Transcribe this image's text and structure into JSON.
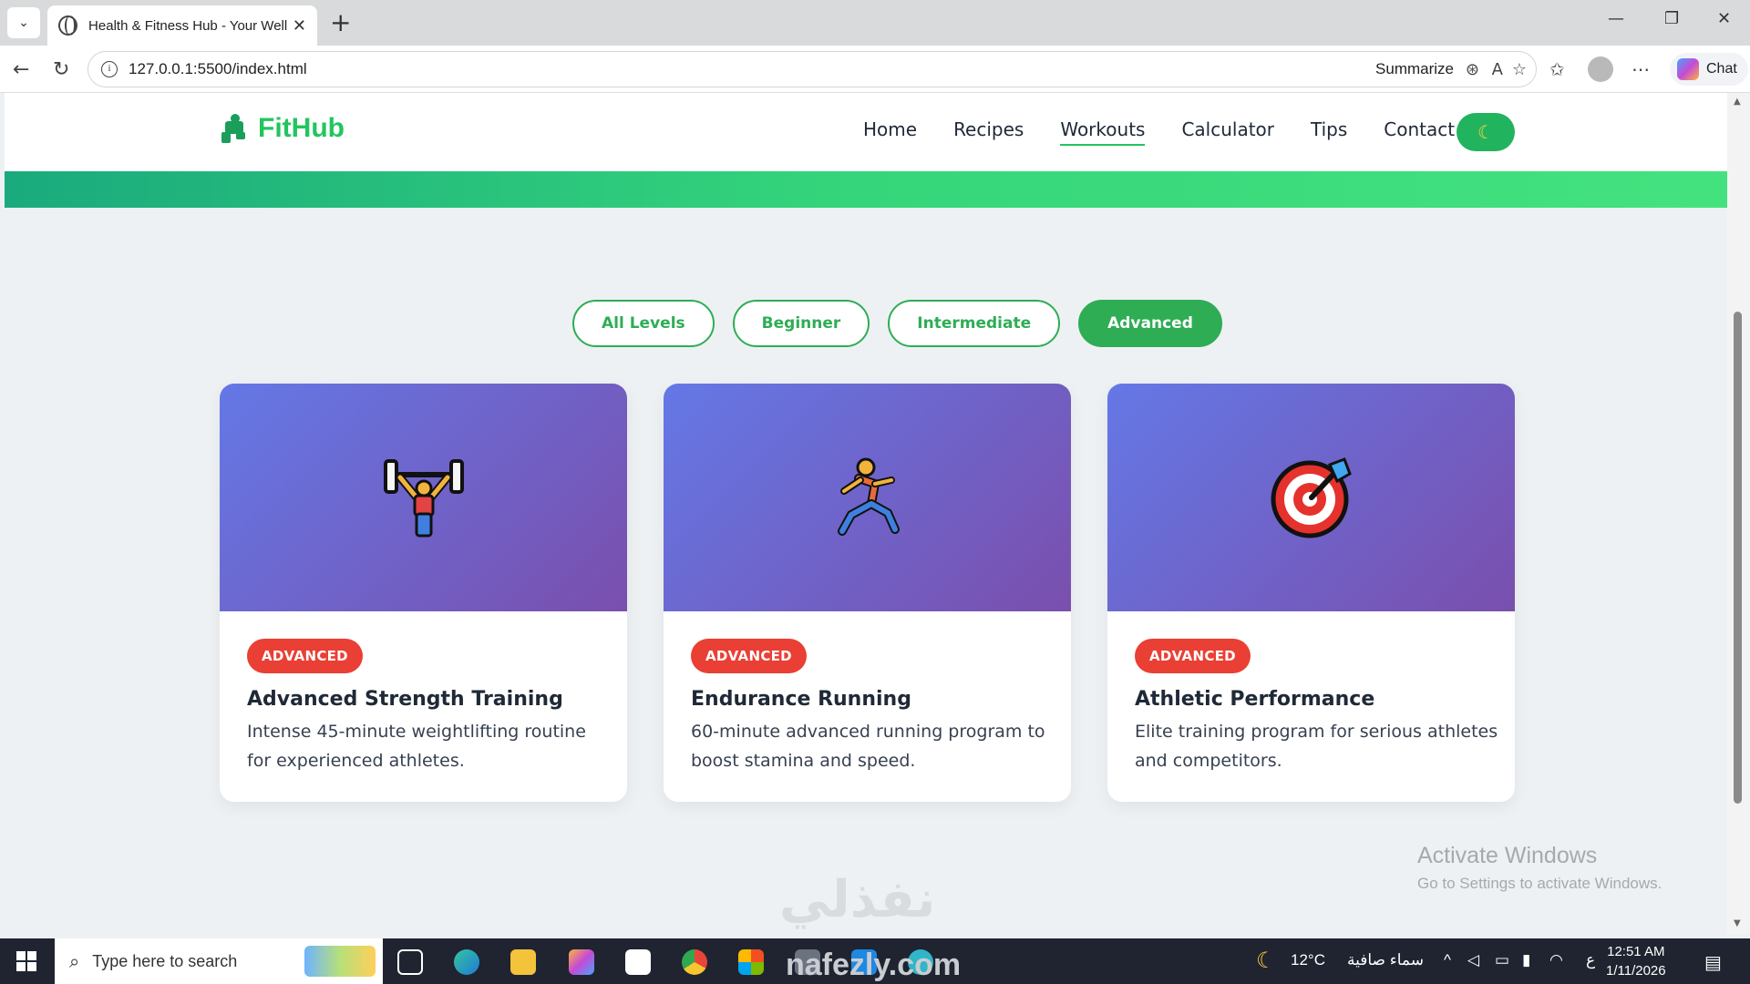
{
  "browser": {
    "tab_title": "Health & Fitness Hub - Your Wellness",
    "url": "127.0.0.1:5500/index.html",
    "summarize_label": "Summarize",
    "chat_label": "Chat"
  },
  "site": {
    "brand": "FitHub",
    "nav": [
      "Home",
      "Recipes",
      "Workouts",
      "Calculator",
      "Tips",
      "Contact"
    ],
    "active_nav": "Workouts",
    "theme_icon": "moon-icon"
  },
  "filters": {
    "items": [
      "All Levels",
      "Beginner",
      "Intermediate",
      "Advanced"
    ],
    "active": "Advanced"
  },
  "cards": [
    {
      "icon": "weightlifter-icon",
      "badge": "ADVANCED",
      "title": "Advanced Strength Training",
      "description": "Intense 45-minute weightlifting routine for experienced athletes."
    },
    {
      "icon": "runner-icon",
      "badge": "ADVANCED",
      "title": "Endurance Running",
      "description": "60-minute advanced running program to boost stamina and speed."
    },
    {
      "icon": "target-icon",
      "badge": "ADVANCED",
      "title": "Athletic Performance",
      "description": "Elite training program for serious athletes and competitors."
    }
  ],
  "overlay": {
    "activate_title": "Activate Windows",
    "activate_sub": "Go to Settings to activate Windows.",
    "watermark": "نفذلي"
  },
  "taskbar": {
    "search_placeholder": "Type here to search",
    "weather": "12°C",
    "weather_text": "سماء صافية",
    "lang": "ع",
    "time": "12:51 AM",
    "date": "1/11/2026",
    "watermark2": "nafezly.com"
  },
  "colors": {
    "brand_green": "#22c55e",
    "filter_green": "#2ead55",
    "badge_red": "#ea3f34",
    "card_gradient_start": "#6478e6",
    "card_gradient_end": "#7a4fad"
  }
}
